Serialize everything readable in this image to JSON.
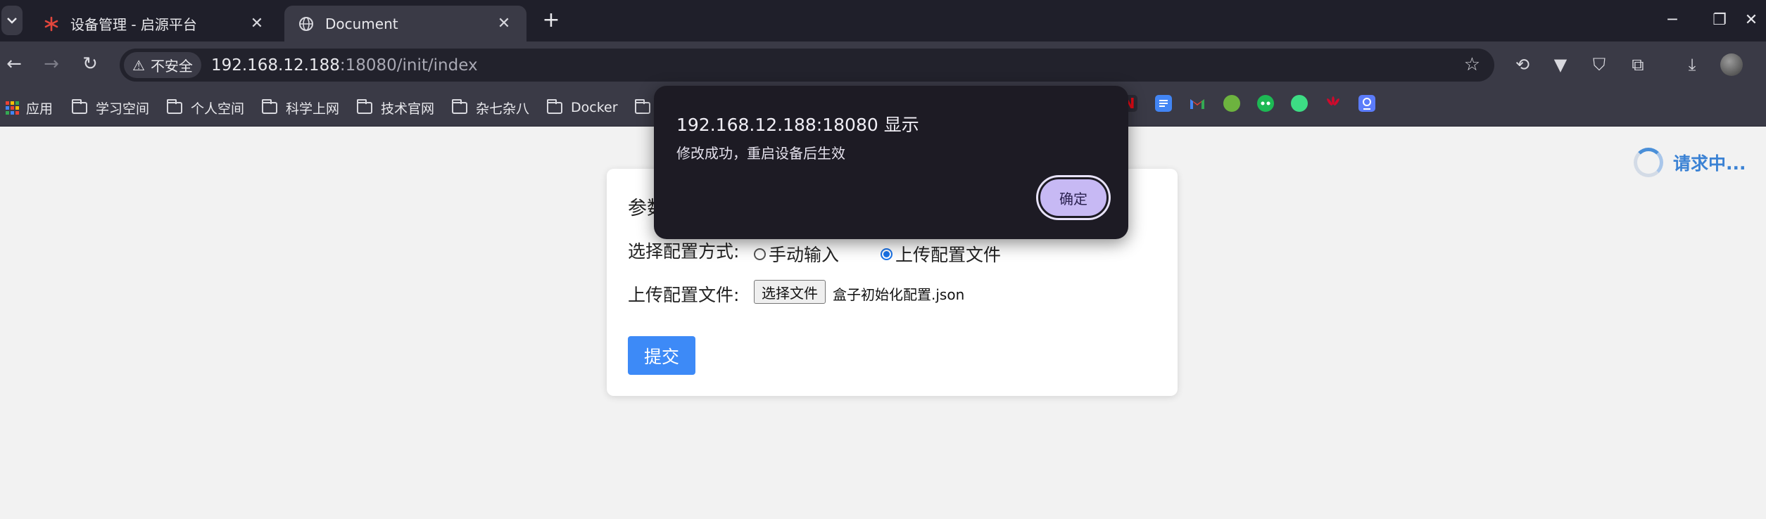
{
  "browser": {
    "tabs": [
      {
        "title": "设备管理 - 启源平台",
        "icon": "red-asterisk-favicon-icon",
        "active": false
      },
      {
        "title": "Document",
        "icon": "globe-icon",
        "active": true
      }
    ],
    "address": {
      "security_label": "不安全",
      "url_host": "192.168.12.188",
      "url_rest": ":18080/init/index"
    },
    "bookmarks": [
      {
        "label": "应用",
        "icon": "apps-grid-icon"
      },
      {
        "label": "学习空间",
        "icon": "folder-icon"
      },
      {
        "label": "个人空间",
        "icon": "folder-icon"
      },
      {
        "label": "科学上网",
        "icon": "folder-icon"
      },
      {
        "label": "技术官网",
        "icon": "folder-icon"
      },
      {
        "label": "杂七杂八",
        "icon": "folder-icon"
      },
      {
        "label": "Docker",
        "icon": "folder-icon"
      }
    ],
    "bookmark_favicons": [
      {
        "name": "red-n-favicon-icon",
        "color": "#e50914"
      },
      {
        "name": "docs-favicon-icon",
        "color": "#4285f4"
      },
      {
        "name": "gmail-favicon-icon",
        "color": "#ea4335"
      },
      {
        "name": "spring-favicon-icon",
        "color": "#6db33f"
      },
      {
        "name": "green-chat-favicon-icon",
        "color": "#1db954"
      },
      {
        "name": "green-robot-favicon-icon",
        "color": "#3ddc84"
      },
      {
        "name": "huawei-favicon-icon",
        "color": "#cf0a2c"
      },
      {
        "name": "blue-app-favicon-icon",
        "color": "#5b7cfa"
      }
    ]
  },
  "page": {
    "card_title": "参数",
    "config_mode_label": "选择配置方式:",
    "radio_manual": "手动输入",
    "radio_upload": "上传配置文件",
    "selected_mode": "上传配置文件",
    "upload_label": "上传配置文件:",
    "file_button": "选择文件",
    "file_name": "盒子初始化配置.json",
    "submit_label": "提交",
    "loading_text": "请求中..."
  },
  "dialog": {
    "title": "192.168.12.188:18080 显示",
    "message": "修改成功，重启设备后生效",
    "ok_label": "确定"
  },
  "colors": {
    "accent_blue": "#3d8af7",
    "loading_blue": "#3b82d4",
    "dialog_bg": "#1d1b24",
    "dialog_button": "#c7b9f4"
  }
}
